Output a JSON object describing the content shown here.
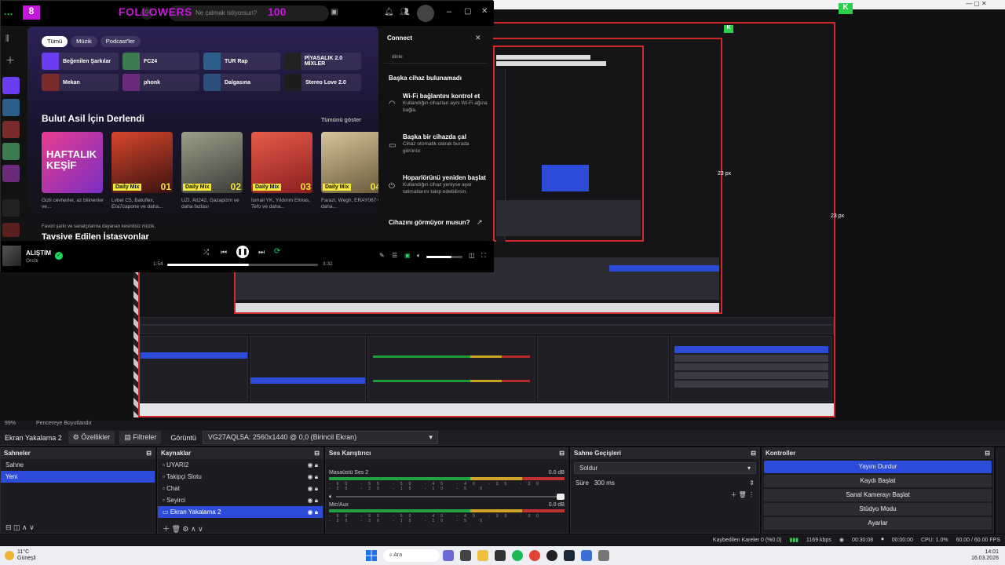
{
  "spotify": {
    "search_placeholder": "Ne çalmak istiyorsun?",
    "overlay": {
      "followers_label": "FOLLOWERS",
      "followers_count": "100",
      "left_badge": "8"
    },
    "filters": [
      "Tümü",
      "Müzik",
      "Podcast'ler"
    ],
    "shortcuts": [
      {
        "label": "Beğenilen Şarkılar",
        "color": "#6a3df0"
      },
      {
        "label": "FC24",
        "color": "#3d7a4f"
      },
      {
        "label": "TUR Rap",
        "color": "#2c5e8c"
      },
      {
        "label": "PİYASALIK 2.0 MİXLER",
        "color": "#222"
      },
      {
        "label": "Mekan",
        "color": "#7a2c2c"
      },
      {
        "label": "phonk",
        "color": "#6a2c7a"
      },
      {
        "label": "Dalgasına",
        "color": "#2c4f7a"
      },
      {
        "label": "Stereo Love 2.0",
        "color": "#1d1d1d"
      }
    ],
    "section_title": "Bulut Asil İçin Derlendi",
    "show_all": "Tümünü göster",
    "cards": [
      {
        "title_art": "HAFTALIK KEŞİF",
        "badge": "",
        "num": "",
        "desc": "Gizli cevherler, az bilinenler ve...",
        "color": "#c2339a"
      },
      {
        "title_art": "",
        "badge": "Daily Mix",
        "num": "01",
        "desc": "Lvbel C5, Batuflex, Era7capone ve daha...",
        "color": "#7a1f1f"
      },
      {
        "title_art": "",
        "badge": "Daily Mix",
        "num": "02",
        "desc": "UZI, Ati242, Gazapizm ve daha fazlası",
        "color": "#8a8f7a"
      },
      {
        "title_art": "",
        "badge": "Daily Mix",
        "num": "03",
        "desc": "İsmail YK, Yıldırım Elmas, Tefo ve daha...",
        "color": "#c43b3b"
      },
      {
        "title_art": "",
        "badge": "Daily Mix",
        "num": "04",
        "desc": "Farazi, Wegh, ERAY067 ve daha...",
        "color": "#c7b28a"
      }
    ],
    "next_section_hint": "Favori şarkı ve sanatçılarına dayanan kesintisiz müzik.",
    "next_section_title": "Tavsiye Edilen İstasyonlar",
    "connect": {
      "title": "Connect",
      "listen_hint": "dinle",
      "no_device": "Başka cihaz bulunamadı",
      "items": [
        {
          "title": "Wi-Fi bağlantını kontrol et",
          "desc": "Kullandığın cihazları aynı Wi-Fi ağına bağla."
        },
        {
          "title": "Başka bir cihazda çal",
          "desc": "Cihaz otomatik olarak burada görünür."
        },
        {
          "title": "Hoparlörünü yeniden başlat",
          "desc": "Kullandığın cihaz yeniyse ayar talimatlarını takip edebilirsin."
        }
      ],
      "footer": "Cihazını görmüyor musun?"
    },
    "player": {
      "track": "ALIŞTIM",
      "artist": "Orchi",
      "elapsed": "1:54",
      "total": "3:32",
      "progress": 0.54,
      "volume": 0.7
    }
  },
  "obs": {
    "zoom_labels": [
      "23 px",
      "23 px"
    ],
    "status_strip": [
      "99%",
      "Pencereye Boyutlandır"
    ],
    "source_bar": {
      "source": "Ekran Yakalama 2",
      "properties": "Özellikler",
      "filters": "Filtreler",
      "display_label": "Görüntü",
      "display_value": "VG27AQL5A: 2560x1440 @ 0,0 (Birincil Ekran)"
    },
    "scenes": {
      "title": "Sahneler",
      "items": [
        "Sahne",
        "Yeni"
      ],
      "selected": 1
    },
    "sources": {
      "title": "Kaynaklar",
      "items": [
        "UYARI2",
        "Takipçi Slotu",
        "Chat",
        "Seyirci",
        "Ekran Yakalama 2"
      ],
      "selected": 4
    },
    "mixer": {
      "title": "Ses Karıştırıcı",
      "channels": [
        {
          "name": "Masaüstü Ses 2",
          "db": "0.0 dB"
        },
        {
          "name": "Mic/Aux",
          "db": "0.0 dB"
        }
      ],
      "ticks": "-60 -55 -50 -45 -40 -35 -30 -25 -20 -15 -10 -5 0"
    },
    "transitions": {
      "title": "Sahne Geçişleri",
      "type": "Soldur",
      "duration_label": "Süre",
      "duration": "300 ms"
    },
    "controls": {
      "title": "Kontroller",
      "buttons": [
        "Yayını Durdur",
        "Kaydı Başlat",
        "Sanal Kamerayı Başlat",
        "Stüdyo Modu",
        "Ayarlar"
      ]
    },
    "statusbar": {
      "dropped": "Kaybedilen Kareler 0 (%0.0)",
      "bitrate": "1169 kbps",
      "stream_time": "00:30:08",
      "rec_time": "00:00:00",
      "cpu": "CPU: 1.0%",
      "fps": "60.00 / 60.00 FPS"
    }
  },
  "taskbar": {
    "weather_temp": "11°C",
    "weather_desc": "Güneşli",
    "search": "Ara",
    "time": "14:01",
    "date": "16.03.2026"
  }
}
